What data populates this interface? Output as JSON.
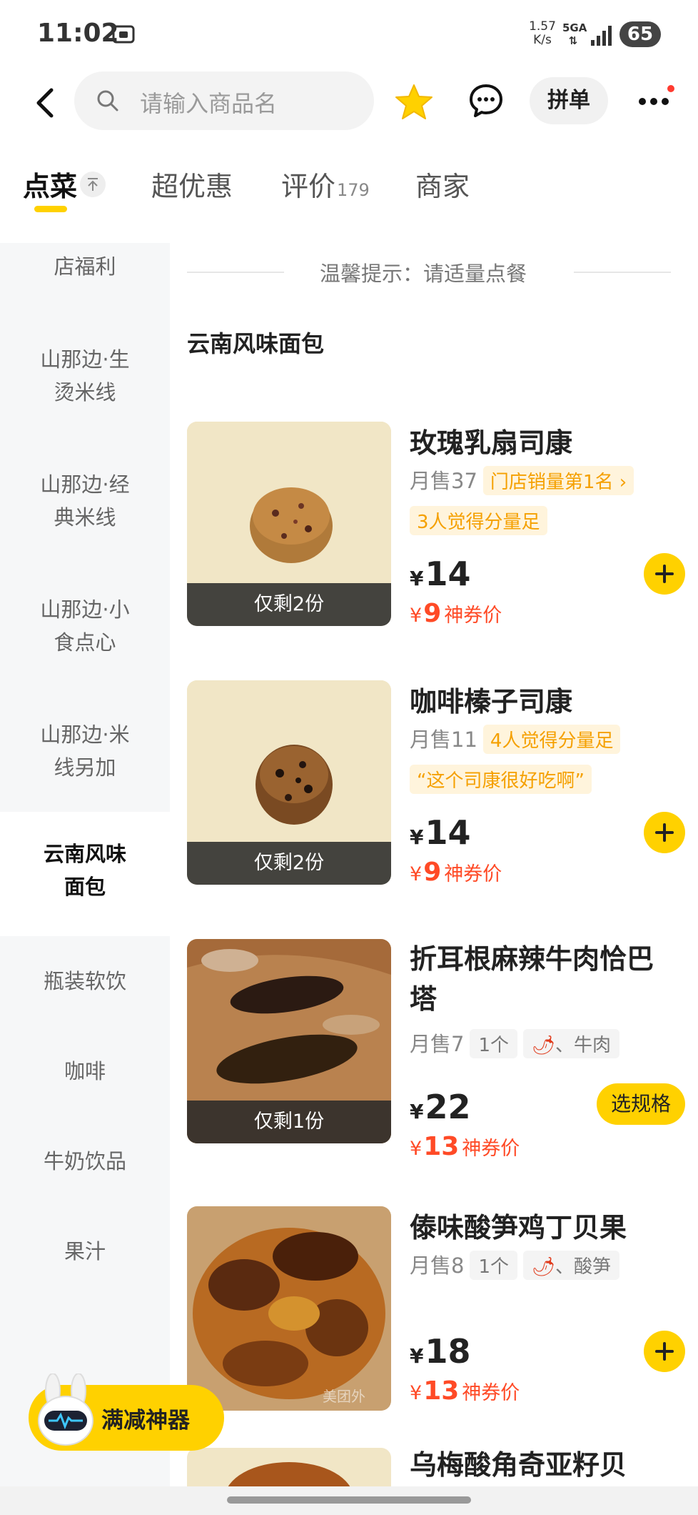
{
  "status_bar": {
    "time": "11:02",
    "net_speed_value": "1.57",
    "net_speed_unit": "K/s",
    "net_type": "5GA",
    "battery": "65"
  },
  "header": {
    "search_placeholder": "请输入商品名",
    "pindan_label": "拼单"
  },
  "tabs": [
    {
      "label": "点菜",
      "count": ""
    },
    {
      "label": "超优惠",
      "count": ""
    },
    {
      "label": "评价",
      "count": "179"
    },
    {
      "label": "商家",
      "count": ""
    }
  ],
  "sidebar": {
    "items": [
      {
        "label": "店福利"
      },
      {
        "label": "山那边·生烫米线"
      },
      {
        "label": "山那边·经典米线"
      },
      {
        "label": "山那边·小食点心"
      },
      {
        "label": "山那边·米线另加"
      },
      {
        "label": "云南风味面包"
      },
      {
        "label": "瓶装软饮"
      },
      {
        "label": "咖啡"
      },
      {
        "label": "牛奶饮品"
      },
      {
        "label": "果汁"
      }
    ],
    "active_label": "云南风味面包"
  },
  "notice": "温馨提示：请适量点餐",
  "section_title": "云南风味面包",
  "items": [
    {
      "name": "玫瑰乳扇司康",
      "sales": "月售37",
      "tag1": "门店销量第1名",
      "tag2": "3人觉得分量足",
      "price": "14",
      "coupon_price": "9",
      "coupon_label": "神券价",
      "stock": "仅剩2份",
      "action": "add"
    },
    {
      "name": "咖啡榛子司康",
      "sales": "月售11",
      "tag1": "4人觉得分量足",
      "tag2": "“这个司康很好吃啊”",
      "price": "14",
      "coupon_price": "9",
      "coupon_label": "神券价",
      "stock": "仅剩2份",
      "action": "add"
    },
    {
      "name": "折耳根麻辣牛肉恰巴塔",
      "sales": "月售7",
      "tag1": "1个",
      "tag2": "、牛肉",
      "price": "22",
      "coupon_price": "13",
      "coupon_label": "神券价",
      "stock": "仅剩1份",
      "action": "选规格"
    },
    {
      "name": "傣味酸笋鸡丁贝果",
      "sales": "月售8",
      "tag1": "1个",
      "tag2": "、酸笋",
      "price": "18",
      "coupon_price": "13",
      "coupon_label": "神券价",
      "stock": "",
      "action": "add"
    },
    {
      "name": "乌梅酸角奇亚籽贝",
      "sales": "",
      "tag1": "",
      "tag2": "",
      "price": "",
      "coupon_price": "",
      "coupon_label": "",
      "stock": "",
      "action": ""
    }
  ],
  "currency_symbol": "¥",
  "watermark": "美团外",
  "floating_badge": "满减神器",
  "colors": {
    "accent_yellow": "#ffd100",
    "coupon_red": "#ff4a26",
    "tag_orange": "#f5a000"
  }
}
